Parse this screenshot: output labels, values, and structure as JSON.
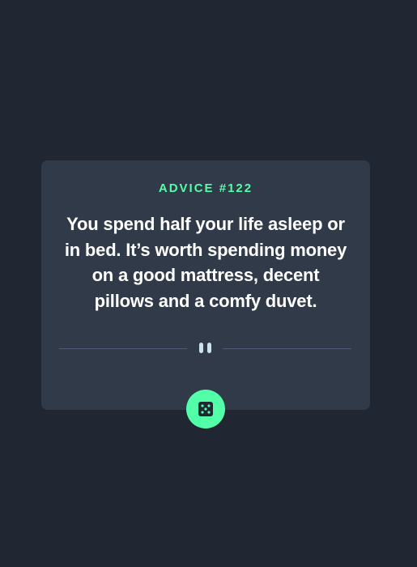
{
  "advice": {
    "label": "ADVICE #122",
    "quote": "You spend half your life asleep or in bed. It’s worth spending money on a good mattress, decent pillows and a comfy duvet."
  },
  "icons": {
    "divider": "pause-icon",
    "button": "dice-icon"
  },
  "colors": {
    "background": "#202632",
    "card": "#313a49",
    "accent": "#52ffa8",
    "text": "#ffffff",
    "divider": "#4f5d74"
  }
}
